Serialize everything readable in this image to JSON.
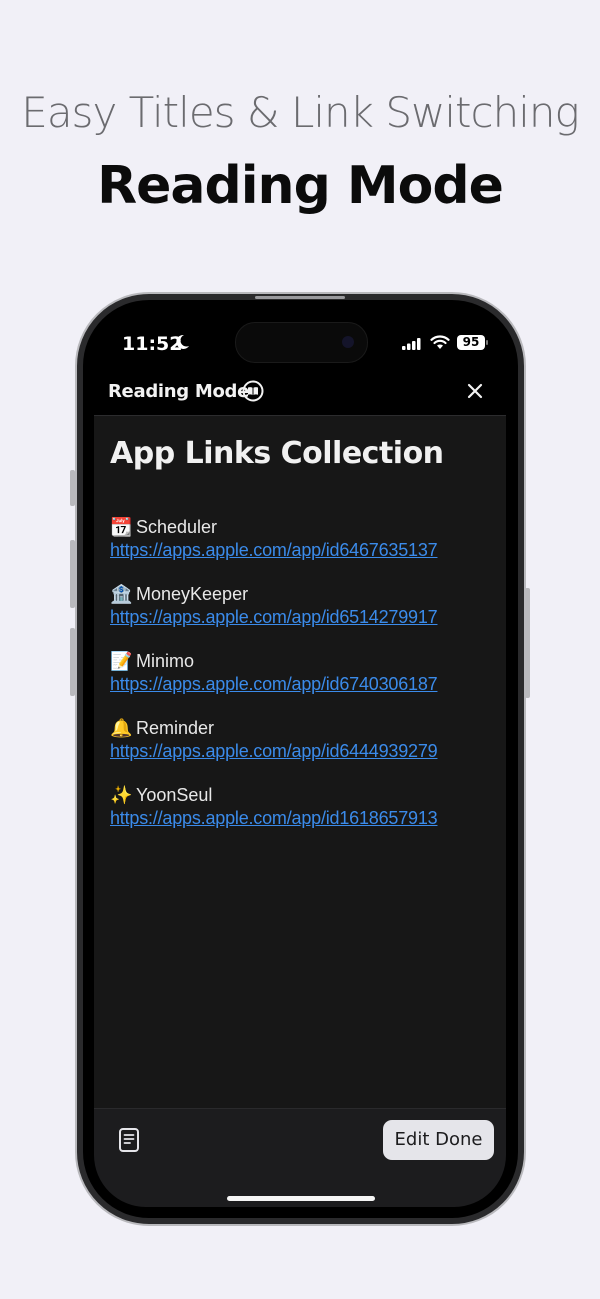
{
  "promo": {
    "subtitle": "Easy Titles & Link Switching",
    "title": "Reading Mode"
  },
  "status_bar": {
    "time": "11:52",
    "battery": "95",
    "icons": [
      "moon-icon",
      "signal-icon",
      "wifi-icon",
      "battery-icon"
    ]
  },
  "navbar": {
    "title": "Reading Mode",
    "icons": [
      "book-icon",
      "close-icon"
    ]
  },
  "document": {
    "title": "App Links Collection",
    "links": [
      {
        "emoji": "📆",
        "name": "Scheduler",
        "url": "https://apps.apple.com/app/id6467635137"
      },
      {
        "emoji": "🏦",
        "name": "MoneyKeeper",
        "url": "https://apps.apple.com/app/id6514279917"
      },
      {
        "emoji": "📝",
        "name": "Minimo",
        "url": "https://apps.apple.com/app/id6740306187"
      },
      {
        "emoji": "🔔",
        "name": "Reminder",
        "url": "https://apps.apple.com/app/id6444939279"
      },
      {
        "emoji": "✨",
        "name": "YoonSeul",
        "url": "https://apps.apple.com/app/id1618657913"
      }
    ]
  },
  "toolbar": {
    "done_label": "Edit Done",
    "icons": [
      "document-icon"
    ]
  },
  "colors": {
    "background": "#f1f0f7",
    "screen_content": "#171717",
    "link": "#3b8bea",
    "button": "#e5e5ea"
  }
}
